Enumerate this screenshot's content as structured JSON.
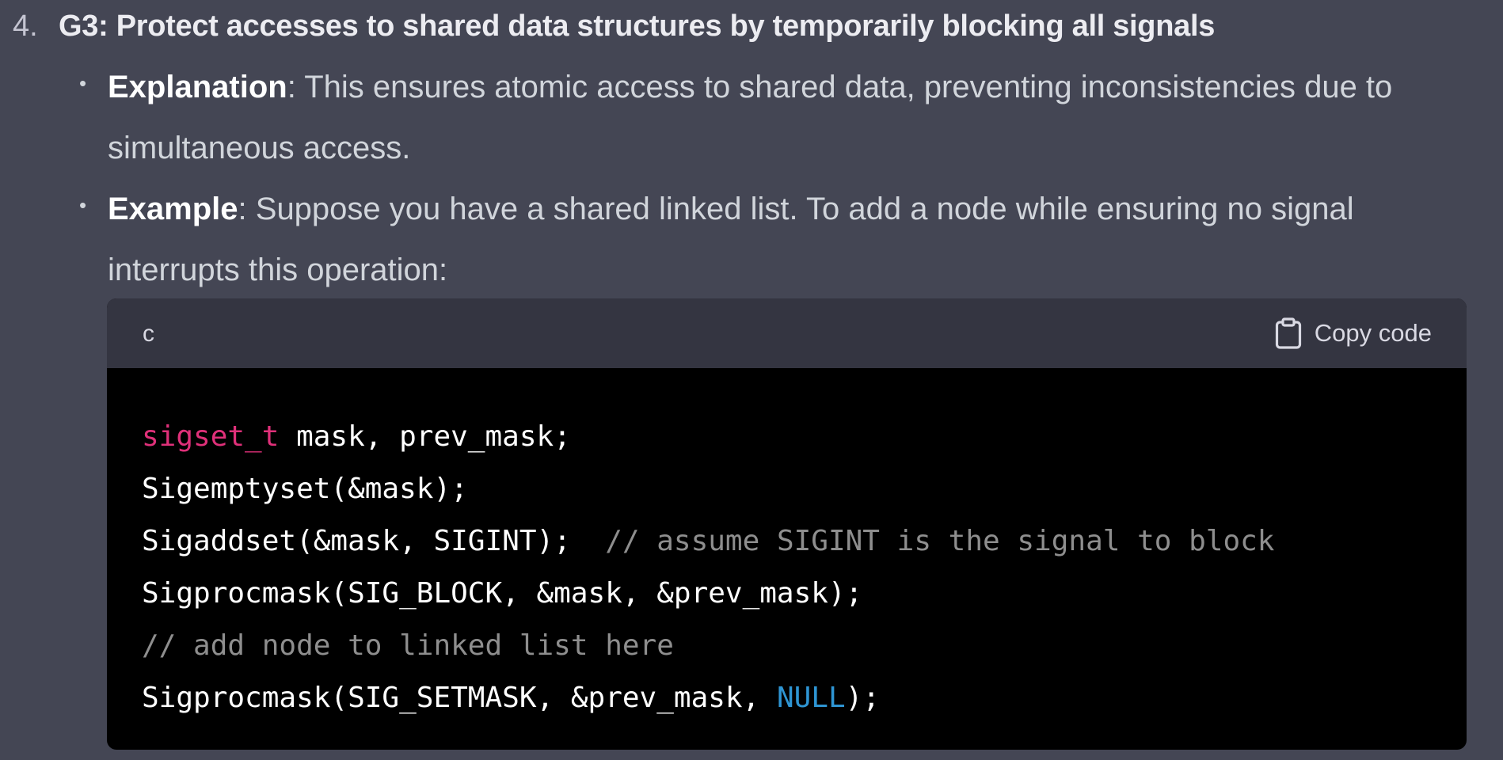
{
  "list_item": {
    "number": "4.",
    "heading": "G3: Protect accesses to shared data structures by temporarily blocking all signals"
  },
  "bullets": [
    {
      "label": "Explanation",
      "text": ": This ensures atomic access to shared data, preventing inconsistencies due to simultaneous access."
    },
    {
      "label": "Example",
      "text": ": Suppose you have a shared linked list. To add a node while ensuring no signal interrupts this operation:"
    }
  ],
  "code_block": {
    "language": "c",
    "copy_label": "Copy code",
    "lines": [
      [
        {
          "t": "sigset_t",
          "c": "type"
        },
        {
          "t": " mask, prev_mask;",
          "c": "plain"
        }
      ],
      [
        {
          "t": "Sigemptyset(&mask);",
          "c": "plain"
        }
      ],
      [
        {
          "t": "Sigaddset(&mask, SIGINT);  ",
          "c": "plain"
        },
        {
          "t": "// assume SIGINT is the signal to block",
          "c": "comment"
        }
      ],
      [
        {
          "t": "Sigprocmask(SIG_BLOCK, &mask, &prev_mask);",
          "c": "plain"
        }
      ],
      [
        {
          "t": "// add node to linked list here",
          "c": "comment"
        }
      ],
      [
        {
          "t": "Sigprocmask(SIG_SETMASK, &prev_mask, ",
          "c": "plain"
        },
        {
          "t": "NULL",
          "c": "literal"
        },
        {
          "t": ");",
          "c": "plain"
        }
      ]
    ]
  },
  "icons": {
    "copy": "clipboard-icon"
  },
  "colors": {
    "background": "#444654",
    "code_header": "#343541",
    "code_body": "#000000",
    "type_keyword": "#df3079",
    "comment": "#8e8e8e",
    "literal": "#2e95d3"
  }
}
